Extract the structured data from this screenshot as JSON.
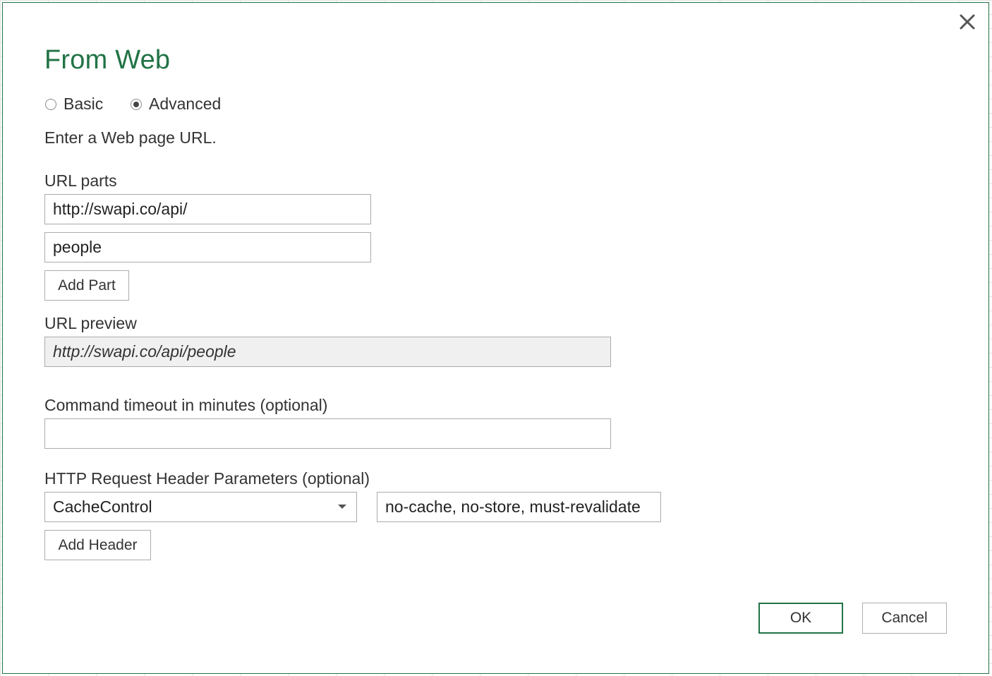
{
  "dialog": {
    "title": "From Web",
    "close_icon": "close-icon"
  },
  "mode": {
    "options": [
      {
        "label": "Basic",
        "selected": false
      },
      {
        "label": "Advanced",
        "selected": true
      }
    ]
  },
  "instruction": "Enter a Web page URL.",
  "url_parts": {
    "label": "URL parts",
    "parts": [
      "http://swapi.co/api/",
      "people"
    ],
    "add_part_label": "Add Part"
  },
  "url_preview": {
    "label": "URL preview",
    "value": "http://swapi.co/api/people"
  },
  "timeout": {
    "label": "Command timeout in minutes (optional)",
    "value": ""
  },
  "headers": {
    "label": "HTTP Request Header Parameters (optional)",
    "name": "CacheControl",
    "value": "no-cache, no-store, must-revalidate",
    "add_header_label": "Add Header"
  },
  "footer": {
    "ok_label": "OK",
    "cancel_label": "Cancel"
  },
  "colors": {
    "accent": "#217346",
    "border": "#ababab",
    "readonly_bg": "#f0f0f0"
  }
}
